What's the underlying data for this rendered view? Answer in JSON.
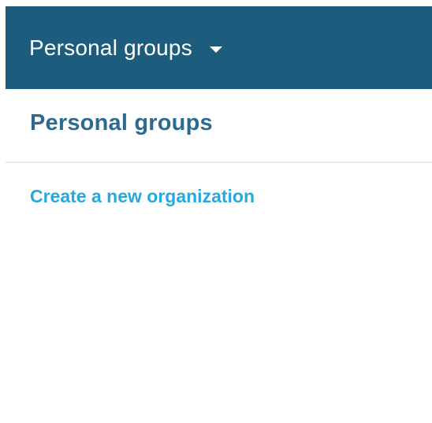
{
  "header": {
    "dropdown_label": "Personal groups",
    "dropdown_icon": "caret-down-icon",
    "background_color": "#1e5c7e"
  },
  "main": {
    "title": "Personal groups",
    "create_link": "Create a new organization",
    "title_color": "#2e6990",
    "link_color": "#27a9dd"
  }
}
